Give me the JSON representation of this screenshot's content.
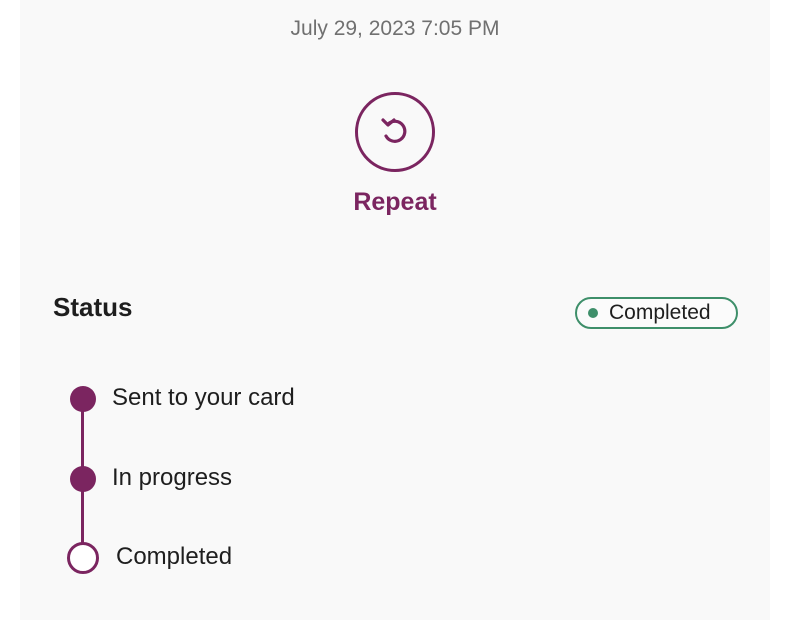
{
  "header": {
    "timestamp": "July 29, 2023 7:05 PM"
  },
  "actions": {
    "repeat_label": "Repeat",
    "repeat_icon": "repeat-icon"
  },
  "status": {
    "title": "Status",
    "badge_label": "Completed",
    "badge_color": "#3e8f6a"
  },
  "timeline": {
    "accent_color": "#7b2560",
    "steps": [
      {
        "label": "Sent to your card",
        "state": "done"
      },
      {
        "label": "In progress",
        "state": "done"
      },
      {
        "label": "Completed",
        "state": "pending"
      }
    ]
  }
}
